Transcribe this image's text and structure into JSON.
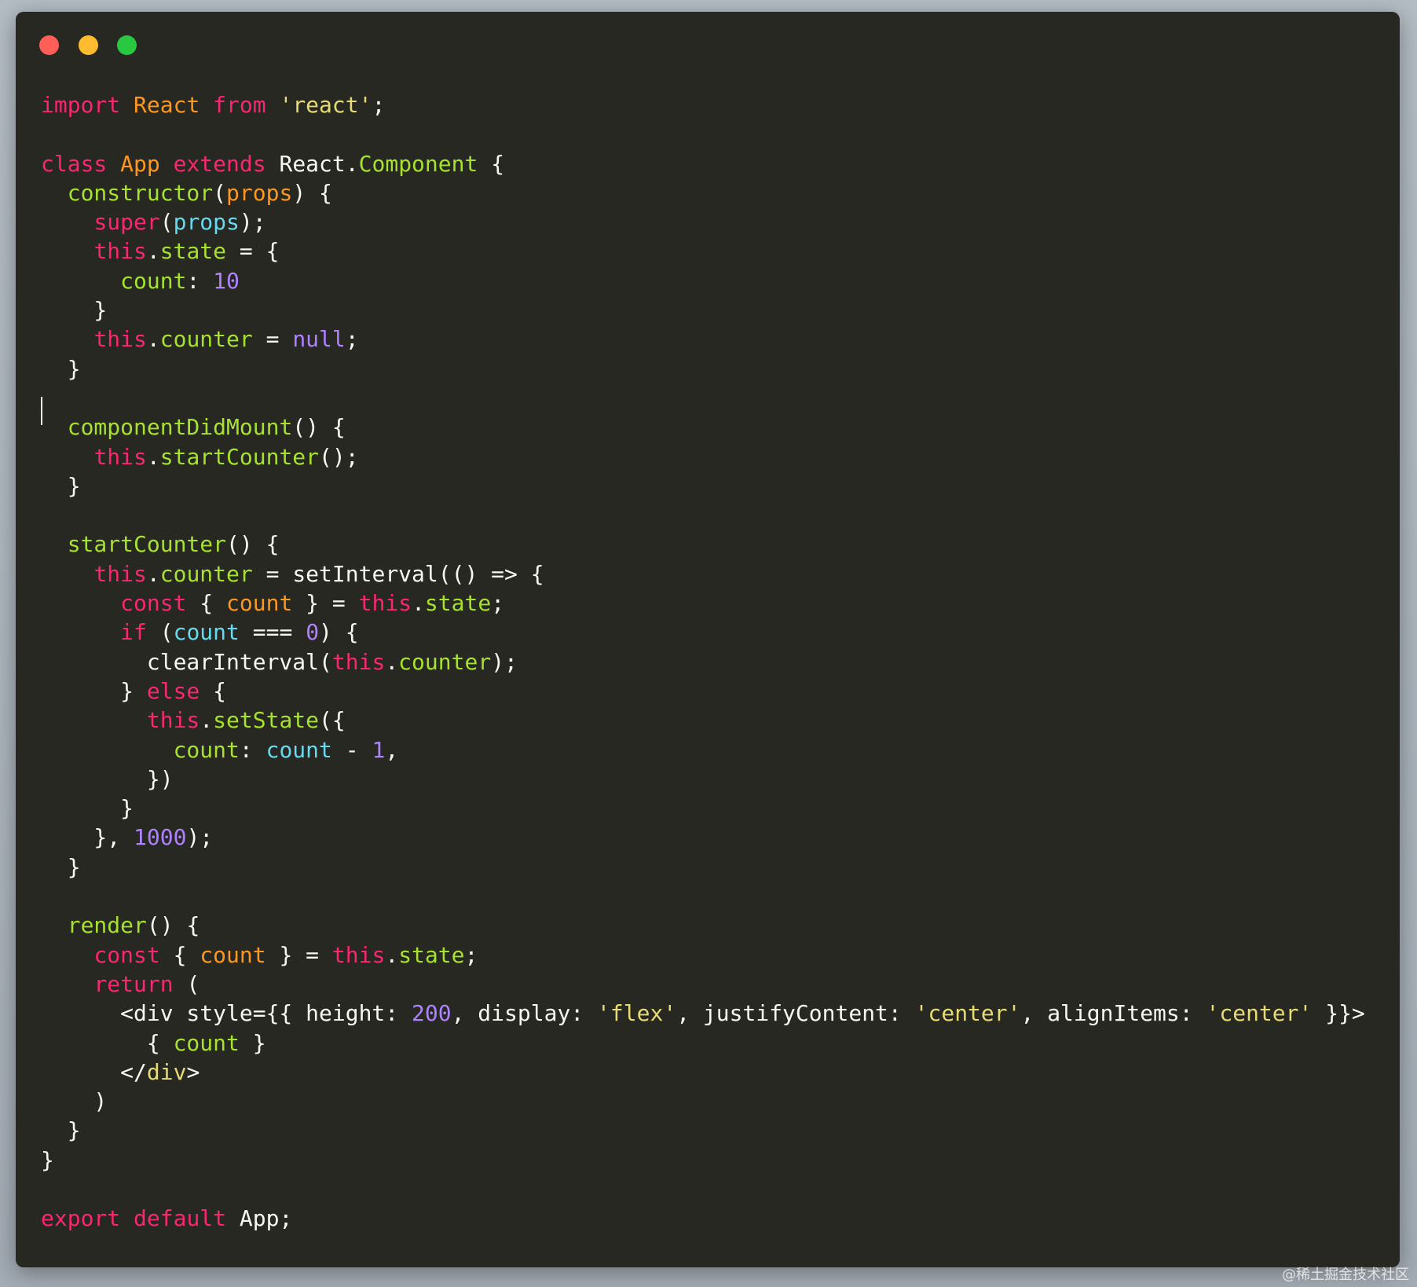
{
  "window": {
    "buttons": [
      {
        "name": "close",
        "color": "#ff5f57"
      },
      {
        "name": "minimize",
        "color": "#febc2e"
      },
      {
        "name": "maximize",
        "color": "#28c840"
      }
    ]
  },
  "colors": {
    "k": "#f92672",
    "c": "#fd971f",
    "s": "#e6db74",
    "f": "#a6e22e",
    "n": "#ae81ff",
    "v": "#66d9ef",
    "p": "#f8f8f2"
  },
  "code_lines": [
    [
      [
        "k",
        "import"
      ],
      [
        "p",
        " "
      ],
      [
        "c",
        "React"
      ],
      [
        "p",
        " "
      ],
      [
        "k",
        "from"
      ],
      [
        "p",
        " "
      ],
      [
        "s",
        "'react'"
      ],
      [
        "p",
        ";"
      ]
    ],
    [],
    [
      [
        "k",
        "class"
      ],
      [
        "p",
        " "
      ],
      [
        "c",
        "App"
      ],
      [
        "p",
        " "
      ],
      [
        "k",
        "extends"
      ],
      [
        "p",
        " React."
      ],
      [
        "f",
        "Component"
      ],
      [
        "p",
        " {"
      ]
    ],
    [
      [
        "p",
        "  "
      ],
      [
        "f",
        "constructor"
      ],
      [
        "p",
        "("
      ],
      [
        "c",
        "props"
      ],
      [
        "p",
        ") {"
      ]
    ],
    [
      [
        "p",
        "    "
      ],
      [
        "k",
        "super"
      ],
      [
        "p",
        "("
      ],
      [
        "v",
        "props"
      ],
      [
        "p",
        ");"
      ]
    ],
    [
      [
        "p",
        "    "
      ],
      [
        "k",
        "this"
      ],
      [
        "p",
        "."
      ],
      [
        "f",
        "state"
      ],
      [
        "p",
        " = {"
      ]
    ],
    [
      [
        "p",
        "      "
      ],
      [
        "f",
        "count"
      ],
      [
        "p",
        ": "
      ],
      [
        "n",
        "10"
      ]
    ],
    [
      [
        "p",
        "    }"
      ]
    ],
    [
      [
        "p",
        "    "
      ],
      [
        "k",
        "this"
      ],
      [
        "p",
        "."
      ],
      [
        "f",
        "counter"
      ],
      [
        "p",
        " = "
      ],
      [
        "n",
        "null"
      ],
      [
        "p",
        ";"
      ]
    ],
    [
      [
        "p",
        "  }"
      ]
    ],
    [],
    [
      [
        "p",
        "  "
      ],
      [
        "f",
        "componentDidMount"
      ],
      [
        "p",
        "() {"
      ]
    ],
    [
      [
        "p",
        "    "
      ],
      [
        "k",
        "this"
      ],
      [
        "p",
        "."
      ],
      [
        "f",
        "startCounter"
      ],
      [
        "p",
        "();"
      ]
    ],
    [
      [
        "p",
        "  }"
      ]
    ],
    [],
    [
      [
        "p",
        "  "
      ],
      [
        "f",
        "startCounter"
      ],
      [
        "p",
        "() {"
      ]
    ],
    [
      [
        "p",
        "    "
      ],
      [
        "k",
        "this"
      ],
      [
        "p",
        "."
      ],
      [
        "f",
        "counter"
      ],
      [
        "p",
        " = setInterval(() => {"
      ]
    ],
    [
      [
        "p",
        "      "
      ],
      [
        "k",
        "const"
      ],
      [
        "p",
        " { "
      ],
      [
        "c",
        "count"
      ],
      [
        "p",
        " } = "
      ],
      [
        "k",
        "this"
      ],
      [
        "p",
        "."
      ],
      [
        "f",
        "state"
      ],
      [
        "p",
        ";"
      ]
    ],
    [
      [
        "p",
        "      "
      ],
      [
        "k",
        "if"
      ],
      [
        "p",
        " ("
      ],
      [
        "v",
        "count"
      ],
      [
        "p",
        " === "
      ],
      [
        "n",
        "0"
      ],
      [
        "p",
        ") {"
      ]
    ],
    [
      [
        "p",
        "        clearInterval("
      ],
      [
        "k",
        "this"
      ],
      [
        "p",
        "."
      ],
      [
        "f",
        "counter"
      ],
      [
        "p",
        ");"
      ]
    ],
    [
      [
        "p",
        "      } "
      ],
      [
        "k",
        "else"
      ],
      [
        "p",
        " {"
      ]
    ],
    [
      [
        "p",
        "        "
      ],
      [
        "k",
        "this"
      ],
      [
        "p",
        "."
      ],
      [
        "f",
        "setState"
      ],
      [
        "p",
        "({"
      ]
    ],
    [
      [
        "p",
        "          "
      ],
      [
        "f",
        "count"
      ],
      [
        "p",
        ": "
      ],
      [
        "v",
        "count"
      ],
      [
        "p",
        " - "
      ],
      [
        "n",
        "1"
      ],
      [
        "p",
        ","
      ]
    ],
    [
      [
        "p",
        "        })"
      ]
    ],
    [
      [
        "p",
        "      }"
      ]
    ],
    [
      [
        "p",
        "    }, "
      ],
      [
        "n",
        "1000"
      ],
      [
        "p",
        ");"
      ]
    ],
    [
      [
        "p",
        "  }"
      ]
    ],
    [],
    [
      [
        "p",
        "  "
      ],
      [
        "f",
        "render"
      ],
      [
        "p",
        "() {"
      ]
    ],
    [
      [
        "p",
        "    "
      ],
      [
        "k",
        "const"
      ],
      [
        "p",
        " { "
      ],
      [
        "c",
        "count"
      ],
      [
        "p",
        " } = "
      ],
      [
        "k",
        "this"
      ],
      [
        "p",
        "."
      ],
      [
        "f",
        "state"
      ],
      [
        "p",
        ";"
      ]
    ],
    [
      [
        "p",
        "    "
      ],
      [
        "k",
        "return"
      ],
      [
        "p",
        " ("
      ]
    ],
    [
      [
        "p",
        "      <div style={{ height: "
      ],
      [
        "n",
        "200"
      ],
      [
        "p",
        ", display: "
      ],
      [
        "s",
        "'flex'"
      ],
      [
        "p",
        ", justifyContent: "
      ],
      [
        "s",
        "'center'"
      ],
      [
        "p",
        ", alignItems: "
      ],
      [
        "s",
        "'center'"
      ],
      [
        "p",
        " }}>"
      ]
    ],
    [
      [
        "p",
        "        { "
      ],
      [
        "f",
        "count"
      ],
      [
        "p",
        " }"
      ]
    ],
    [
      [
        "p",
        "      </"
      ],
      [
        "s",
        "div"
      ],
      [
        "p",
        ">"
      ]
    ],
    [
      [
        "p",
        "    )"
      ]
    ],
    [
      [
        "p",
        "  }"
      ]
    ],
    [
      [
        "p",
        "}"
      ]
    ],
    [],
    [
      [
        "k",
        "export"
      ],
      [
        "p",
        " "
      ],
      [
        "k",
        "default"
      ],
      [
        "p",
        " App;"
      ]
    ]
  ],
  "watermark": "@稀土掘金技术社区"
}
